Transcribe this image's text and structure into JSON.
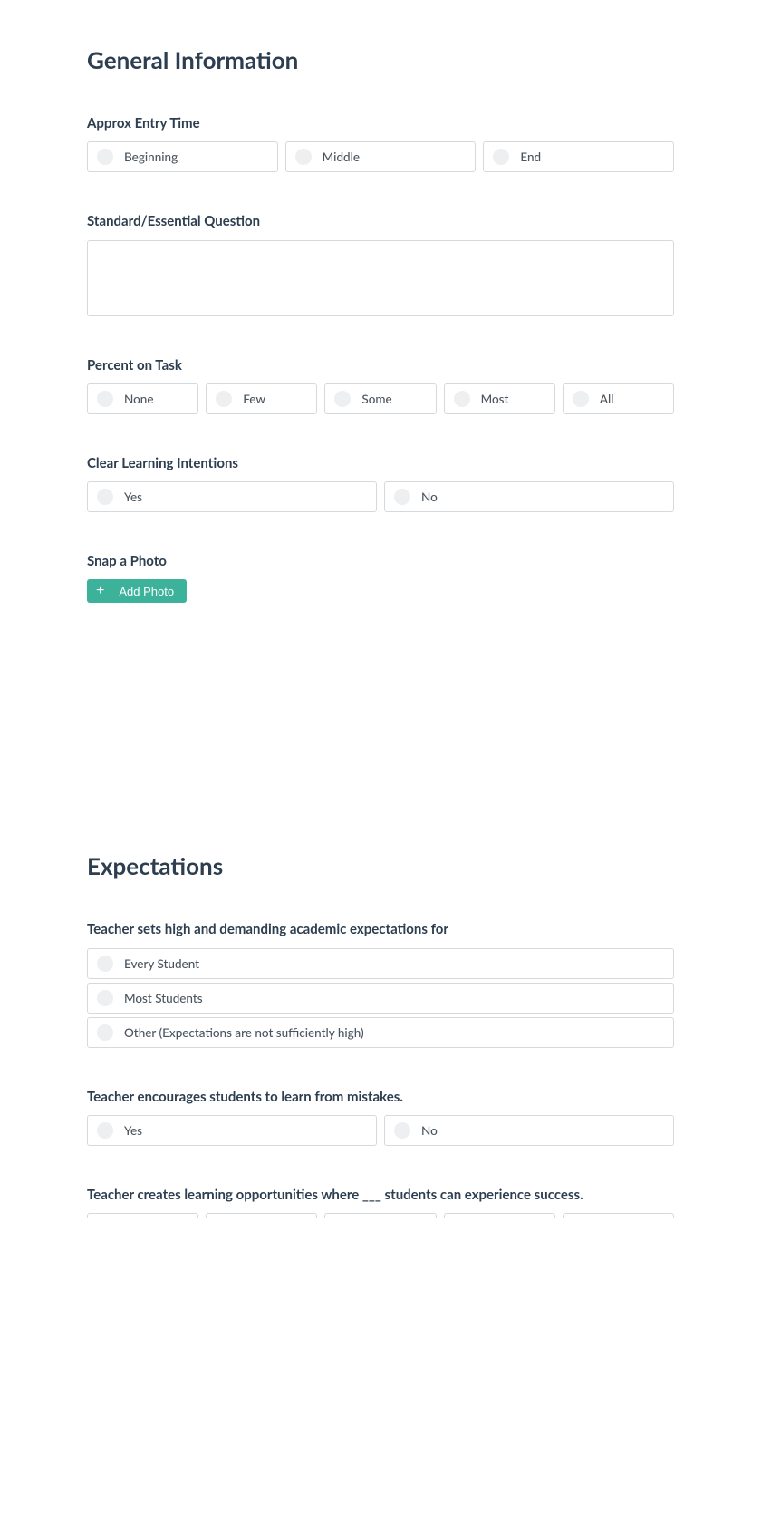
{
  "section1": {
    "title": "General Information",
    "q1": {
      "label": "Approx Entry Time",
      "options": [
        "Beginning",
        "Middle",
        "End"
      ]
    },
    "q2": {
      "label": "Standard/Essential Question",
      "value": ""
    },
    "q3": {
      "label": "Percent on Task",
      "options": [
        "None",
        "Few",
        "Some",
        "Most",
        "All"
      ]
    },
    "q4": {
      "label": "Clear Learning Intentions",
      "options": [
        "Yes",
        "No"
      ]
    },
    "q5": {
      "label": "Snap a Photo",
      "button": "Add Photo"
    }
  },
  "section2": {
    "title": "Expectations",
    "q1": {
      "label": "Teacher sets high and demanding academic expectations for",
      "options": [
        "Every Student",
        "Most Students",
        "Other (Expectations are not sufficiently high)"
      ]
    },
    "q2": {
      "label": "Teacher encourages students to learn from mistakes.",
      "options": [
        "Yes",
        "No"
      ]
    },
    "q3": {
      "label": "Teacher creates learning opportunities where ___ students can experience success."
    }
  }
}
